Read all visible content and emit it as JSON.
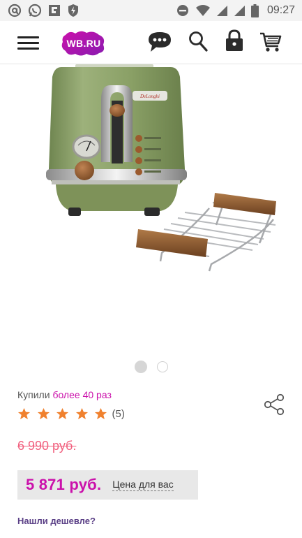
{
  "status_bar": {
    "time": "09:27",
    "left_icons": [
      "at-sign-icon",
      "whatsapp-icon",
      "flipboard-icon",
      "shield-bolt-icon"
    ],
    "right_icons": [
      "do-not-disturb-icon",
      "wifi-icon",
      "signal-icon",
      "signal-icon",
      "battery-icon"
    ]
  },
  "header": {
    "logo_text": "WB.RU",
    "icons": [
      "menu-icon",
      "chat-icon",
      "search-icon",
      "lock-icon",
      "cart-icon"
    ]
  },
  "gallery": {
    "total_slides": 2,
    "active_slide": 1,
    "toaster_brand": "DeLonghi"
  },
  "product": {
    "bought_prefix": "Купили",
    "bought_count": "более 40 раз",
    "rating": 5,
    "reviews": "(5)",
    "old_price": "6 990 руб.",
    "price": "5 871 руб.",
    "price_note": "Цена для вас",
    "cheaper_link": "Нашли дешевле?"
  },
  "colors": {
    "brand": "#cb11ab",
    "star": "#f0812e",
    "old_price": "#f1617f",
    "link": "#5a3f86",
    "toaster_body": "#8ea26a"
  }
}
